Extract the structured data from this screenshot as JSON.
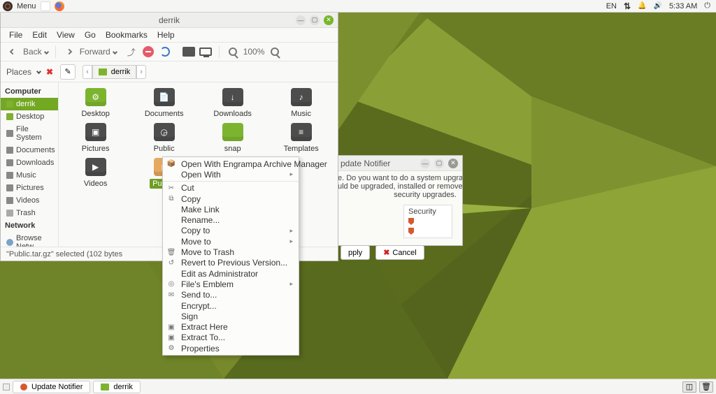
{
  "topbar": {
    "menu_label": "Menu",
    "lang": "EN",
    "time": "5:33 AM"
  },
  "wallpaper": "green-polygons",
  "file_manager": {
    "title": "derrik",
    "menubar": [
      "File",
      "Edit",
      "View",
      "Go",
      "Bookmarks",
      "Help"
    ],
    "toolbar": {
      "back_label": "Back",
      "forward_label": "Forward",
      "zoom_text": "100%"
    },
    "location_row": {
      "places_label": "Places",
      "crumb_label": "derrik"
    },
    "sidebar": {
      "sections": [
        {
          "title": "Computer",
          "items": [
            {
              "label": "derrik",
              "icon": "green",
              "selected": true
            },
            {
              "label": "Desktop",
              "icon": "green",
              "selected": false
            },
            {
              "label": "File System",
              "icon": "gray",
              "selected": false
            },
            {
              "label": "Documents",
              "icon": "gray",
              "selected": false
            },
            {
              "label": "Downloads",
              "icon": "gray",
              "selected": false
            },
            {
              "label": "Music",
              "icon": "gray",
              "selected": false
            },
            {
              "label": "Pictures",
              "icon": "gray",
              "selected": false
            },
            {
              "label": "Videos",
              "icon": "gray",
              "selected": false
            },
            {
              "label": "Trash",
              "icon": "trash",
              "selected": false
            }
          ]
        },
        {
          "title": "Network",
          "items": [
            {
              "label": "Browse Netw...",
              "icon": "net",
              "selected": false
            }
          ]
        }
      ]
    },
    "files": [
      {
        "label": "Desktop",
        "kind": "green",
        "glyph": "⚙"
      },
      {
        "label": "Documents",
        "kind": "dark",
        "glyph": "📄"
      },
      {
        "label": "Downloads",
        "kind": "dark",
        "glyph": "↓"
      },
      {
        "label": "Music",
        "kind": "dark",
        "glyph": "♪"
      },
      {
        "label": "Pictures",
        "kind": "dark",
        "glyph": "▣"
      },
      {
        "label": "Public",
        "kind": "dark",
        "glyph": "◶"
      },
      {
        "label": "snap",
        "kind": "green",
        "glyph": ""
      },
      {
        "label": "Templates",
        "kind": "dark",
        "glyph": "≡"
      },
      {
        "label": "Videos",
        "kind": "dark",
        "glyph": "▶"
      },
      {
        "label": "Publ…",
        "kind": "tar",
        "glyph": "≣",
        "selected": true
      }
    ],
    "statusbar": "\"Public.tar.gz\" selected (102 bytes"
  },
  "context_menu": {
    "items": [
      {
        "label": "Open With Engrampa Archive Manager",
        "icon": "box"
      },
      {
        "label": "Open With",
        "submenu": true
      },
      {
        "sep": true
      },
      {
        "label": "Cut",
        "icon": "cut"
      },
      {
        "label": "Copy",
        "icon": "copy"
      },
      {
        "label": "Make Link"
      },
      {
        "label": "Rename..."
      },
      {
        "label": "Copy to",
        "submenu": true
      },
      {
        "label": "Move to",
        "submenu": true
      },
      {
        "label": "Move to Trash",
        "icon": "trash"
      },
      {
        "label": "Revert to Previous Version...",
        "icon": "revert"
      },
      {
        "label": "Edit as Administrator"
      },
      {
        "label": "File's Emblem",
        "icon": "emblem",
        "submenu": true
      },
      {
        "label": "Send to...",
        "icon": "send"
      },
      {
        "label": "Encrypt..."
      },
      {
        "label": "Sign"
      },
      {
        "label": "Extract Here",
        "icon": "extract"
      },
      {
        "label": "Extract To...",
        "icon": "extract"
      },
      {
        "label": "Properties",
        "icon": "gear"
      }
    ]
  },
  "update_notifier": {
    "title": "pdate Notifier",
    "lines": [
      "e. Do you want to do a system upgrade?",
      "uld be upgraded, installed or removed.",
      "security upgrades."
    ],
    "column_header": "Security",
    "apply_label": "pply",
    "cancel_label": "Cancel"
  },
  "bottombar": {
    "tasks": [
      {
        "label": "Update Notifier",
        "icon": "notifier"
      },
      {
        "label": "derrik",
        "icon": "folder-green"
      }
    ]
  }
}
